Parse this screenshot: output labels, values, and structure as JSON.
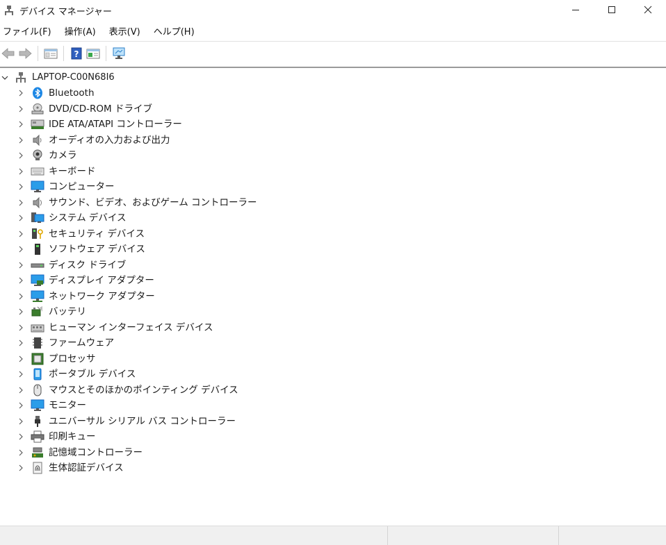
{
  "window": {
    "title": "デバイス マネージャー",
    "icon": "device-manager-icon"
  },
  "menubar": {
    "items": [
      "ファイル(F)",
      "操作(A)",
      "表示(V)",
      "ヘルプ(H)"
    ]
  },
  "toolbar": {
    "buttons": [
      "back-arrow-icon",
      "forward-arrow-icon",
      "show-hide-console-tree-icon",
      "help-icon",
      "properties-icon",
      "scan-hardware-icon"
    ]
  },
  "tree": {
    "root": {
      "label": "LAPTOP-C00N68I6",
      "expanded": true
    },
    "devices": [
      {
        "label": "Bluetooth",
        "icon": "bluetooth-icon"
      },
      {
        "label": "DVD/CD-ROM ドライブ",
        "icon": "dvd-drive-icon"
      },
      {
        "label": "IDE ATA/ATAPI コントローラー",
        "icon": "ide-controller-icon"
      },
      {
        "label": "オーディオの入力および出力",
        "icon": "speaker-icon"
      },
      {
        "label": "カメラ",
        "icon": "camera-icon"
      },
      {
        "label": "キーボード",
        "icon": "keyboard-icon"
      },
      {
        "label": "コンピューター",
        "icon": "computer-icon"
      },
      {
        "label": "サウンド、ビデオ、およびゲーム コントローラー",
        "icon": "sound-icon"
      },
      {
        "label": "システム デバイス",
        "icon": "system-device-icon"
      },
      {
        "label": "セキュリティ デバイス",
        "icon": "security-key-icon"
      },
      {
        "label": "ソフトウェア デバイス",
        "icon": "software-device-icon"
      },
      {
        "label": "ディスク ドライブ",
        "icon": "disk-drive-icon"
      },
      {
        "label": "ディスプレイ アダプター",
        "icon": "display-adapter-icon"
      },
      {
        "label": "ネットワーク アダプター",
        "icon": "network-adapter-icon"
      },
      {
        "label": "バッテリ",
        "icon": "battery-icon"
      },
      {
        "label": "ヒューマン インターフェイス デバイス",
        "icon": "hid-icon"
      },
      {
        "label": "ファームウェア",
        "icon": "firmware-icon"
      },
      {
        "label": "プロセッサ",
        "icon": "processor-icon"
      },
      {
        "label": "ポータブル デバイス",
        "icon": "portable-device-icon"
      },
      {
        "label": "マウスとそのほかのポインティング デバイス",
        "icon": "mouse-icon"
      },
      {
        "label": "モニター",
        "icon": "monitor-icon"
      },
      {
        "label": "ユニバーサル シリアル バス コントローラー",
        "icon": "usb-icon"
      },
      {
        "label": "印刷キュー",
        "icon": "printer-icon"
      },
      {
        "label": "記憶域コントローラー",
        "icon": "storage-controller-icon"
      },
      {
        "label": "生体認証デバイス",
        "icon": "fingerprint-icon"
      }
    ]
  },
  "colors": {
    "accent_blue": "#1e88e5",
    "monitor_blue": "#2b9de9",
    "chip_green": "#3a7d2c"
  }
}
